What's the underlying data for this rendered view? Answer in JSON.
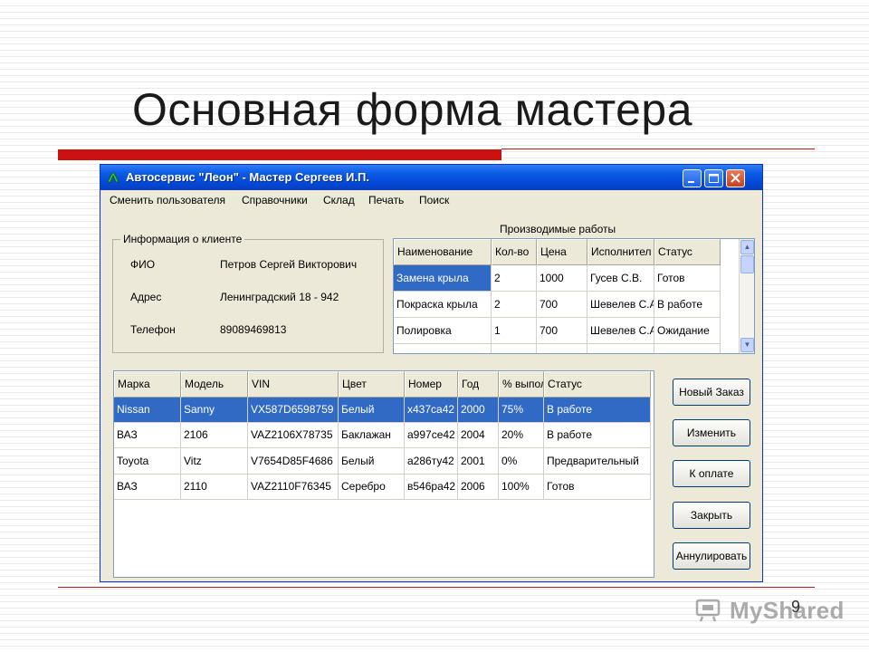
{
  "slide": {
    "title": "Основная форма мастера",
    "page_number": "9",
    "watermark": "MyShared"
  },
  "window": {
    "title": "Автосервис \"Леон\" - Мастер Сергеев И.П.",
    "menu": [
      "Сменить пользователя",
      "Справочники",
      "Склад",
      "Печать",
      "Поиск"
    ]
  },
  "client_info": {
    "legend": "Информация о клиенте",
    "fields": [
      {
        "label": "ФИО",
        "value": "Петров Сергей Викторович"
      },
      {
        "label": "Адрес",
        "value": "Ленинградский 18 - 942"
      },
      {
        "label": "Телефон",
        "value": "89089469813"
      }
    ]
  },
  "works": {
    "label": "Производимые работы",
    "columns": [
      "Наименование",
      "Кол-во",
      "Цена",
      "Исполнител",
      "Статус"
    ],
    "rows": [
      [
        "Замена крыла",
        "2",
        "1000",
        "Гусев С.В.",
        "Готов"
      ],
      [
        "Покраска крыла",
        "2",
        "700",
        "Шевелев С.А",
        "В работе"
      ],
      [
        "Полировка",
        "1",
        "700",
        "Шевелев С.А",
        "Ожидание"
      ]
    ]
  },
  "cars": {
    "columns": [
      "Марка",
      "Модель",
      "VIN",
      "Цвет",
      "Номер",
      "Год",
      "% выпол",
      "Статус"
    ],
    "rows": [
      [
        "Nissan",
        "Sanny",
        "VX587D6598759",
        "Белый",
        "x437ca42",
        "2000",
        "75%",
        "В работе"
      ],
      [
        "ВАЗ",
        "2106",
        "VAZ2106X78735",
        "Баклажан",
        "a997ce42",
        "2004",
        "20%",
        "В работе"
      ],
      [
        "Toyota",
        "Vitz",
        "V7654D85F4686",
        "Белый",
        "a286ту42",
        "2001",
        "0%",
        "Предварительный"
      ],
      [
        "ВАЗ",
        "2110",
        "VAZ2110F76345",
        "Серебро",
        "в546ра42",
        "2006",
        "100%",
        "Готов"
      ]
    ]
  },
  "buttons": {
    "new_order": "Новый Заказ",
    "edit": "Изменить",
    "to_payment": "К оплате",
    "close": "Закрыть",
    "cancel": "Аннулировать"
  },
  "colors": {
    "accent_red": "#cc1111",
    "selection_blue": "#316ac5",
    "titlebar_blue": "#0a5ae6"
  }
}
